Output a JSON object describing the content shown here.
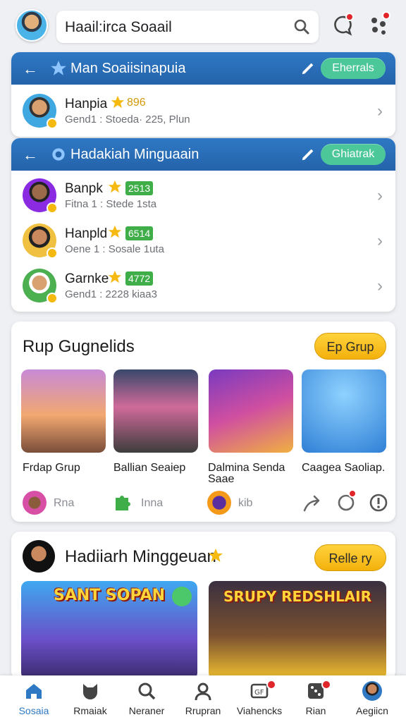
{
  "topbar": {
    "search_text": "Haail:irca Soaail",
    "icons": [
      "avatar",
      "search-icon",
      "chat-icon",
      "apps-icon"
    ]
  },
  "panel1": {
    "title": "Man Soaiisinapuia",
    "button": "Eherrals",
    "items": [
      {
        "name": "Hanpia",
        "score": "896",
        "sub": "Gend1 : Stoeda· 225, Plun"
      }
    ]
  },
  "panel2": {
    "title": "Hadakiah Minguaain",
    "button": "Ghiatrak",
    "items": [
      {
        "name": "Banpk",
        "score": "2513",
        "sub": "Fitna 1 : Stede 1sta"
      },
      {
        "name": "Hanpld",
        "score": "6514",
        "sub": "Oene 1 : Sosale 1uta"
      },
      {
        "name": "Garnke",
        "score": "4772",
        "sub": "Gend1 : 2228  kiaa3"
      }
    ]
  },
  "groups": {
    "title": "Rup Gugnelids",
    "button": "Ep Grup",
    "cards": [
      {
        "label": "Frdap Grup"
      },
      {
        "label": "Ballian Seaiep"
      },
      {
        "label": "Dalmina Senda Saae"
      },
      {
        "label": "Caagea Saoliap."
      }
    ],
    "meta": [
      {
        "text": "Rna"
      },
      {
        "text": "Inna"
      },
      {
        "text": "kib"
      }
    ]
  },
  "weekly": {
    "title": "Hadiiarh Minggeuan",
    "button": "Relle ry",
    "banners": [
      {
        "text": "SANT SOPAN"
      },
      {
        "text": "SRUPY REDSHLAIR"
      }
    ]
  },
  "nav": {
    "items": [
      {
        "label": "Sosaia",
        "active": true
      },
      {
        "label": "Rmaiak"
      },
      {
        "label": "Neraner"
      },
      {
        "label": "Rrupran"
      },
      {
        "label": "Viahencks"
      },
      {
        "label": "Rian"
      },
      {
        "label": "Aegiicn"
      }
    ]
  }
}
